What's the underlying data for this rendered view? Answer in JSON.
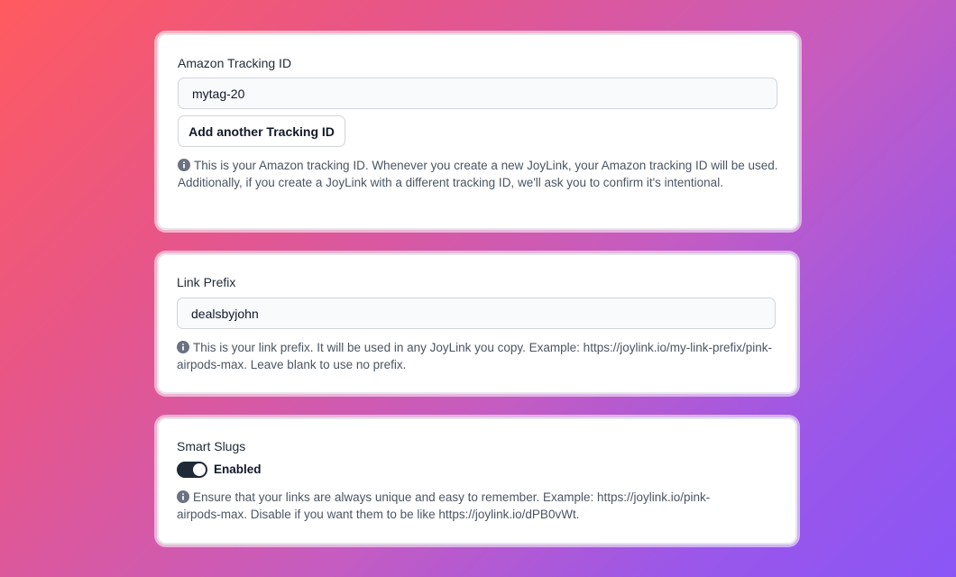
{
  "tracking": {
    "label": "Amazon Tracking ID",
    "value": "mytag-20",
    "add_button": "Add another Tracking ID",
    "help": "This is your Amazon tracking ID. Whenever you create a new JoyLink, your Amazon tracking ID will be used. Additionally, if you create a JoyLink with a different tracking ID, we'll ask you to confirm it's intentional."
  },
  "prefix": {
    "label": "Link Prefix",
    "value": "dealsbyjohn",
    "help": "This is your link prefix. It will be used in any JoyLink you copy. Example: https://joylink.io/my-link-prefix/pink-airpods-max. Leave blank to use no prefix."
  },
  "smart_slugs": {
    "label": "Smart Slugs",
    "toggle_label": "Enabled",
    "enabled": true,
    "help": "Ensure that your links are always unique and easy to remember. Example: https://joylink.io/pink-airpods-max. Disable if you want them to be like https://joylink.io/dPB0vWt."
  },
  "colors": {
    "gradient_start": "#ff5a5f",
    "gradient_end": "#8b55f6",
    "toggle_on": "#1f2937",
    "card": "#ffffff"
  },
  "icons": {
    "help": "info-circle-icon"
  }
}
